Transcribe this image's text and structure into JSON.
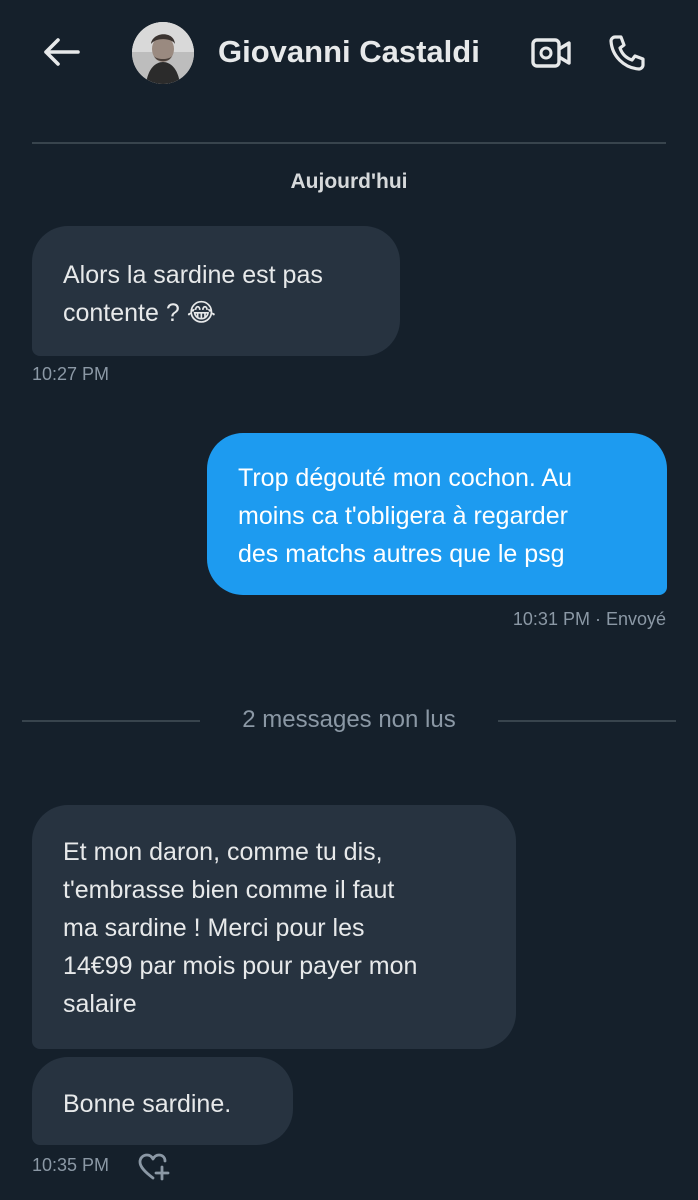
{
  "header": {
    "contact_name": "Giovanni Castaldi",
    "back_icon": "arrow-left-icon",
    "video_icon": "video-camera-icon",
    "call_icon": "phone-icon"
  },
  "conversation": {
    "day_label": "Aujourd'hui",
    "messages": [
      {
        "direction": "received",
        "text": "Alors la sardine est pas\ncontente ? 😂",
        "time": "10:27 PM"
      },
      {
        "direction": "sent",
        "text": "Trop dégouté mon cochon. Au\nmoins ca t'obligera à regarder\ndes matchs autres que le psg",
        "time": "10:31 PM · Envoyé"
      },
      {
        "direction": "received",
        "text": "Et mon daron, comme tu dis,\nt'embrasse bien comme il faut\nma sardine ! Merci pour les\n14€99 par mois pour payer mon\nsalaire"
      },
      {
        "direction": "received",
        "text": "Bonne sardine.",
        "time": "10:35 PM"
      }
    ],
    "unread_label": "2 messages non lus",
    "react_icon": "heart-plus-icon"
  },
  "colors": {
    "background": "#15202b",
    "received_bubble": "#273340",
    "sent_bubble": "#1d9bf0",
    "muted_text": "#8b98a5",
    "divider": "#38444d"
  }
}
